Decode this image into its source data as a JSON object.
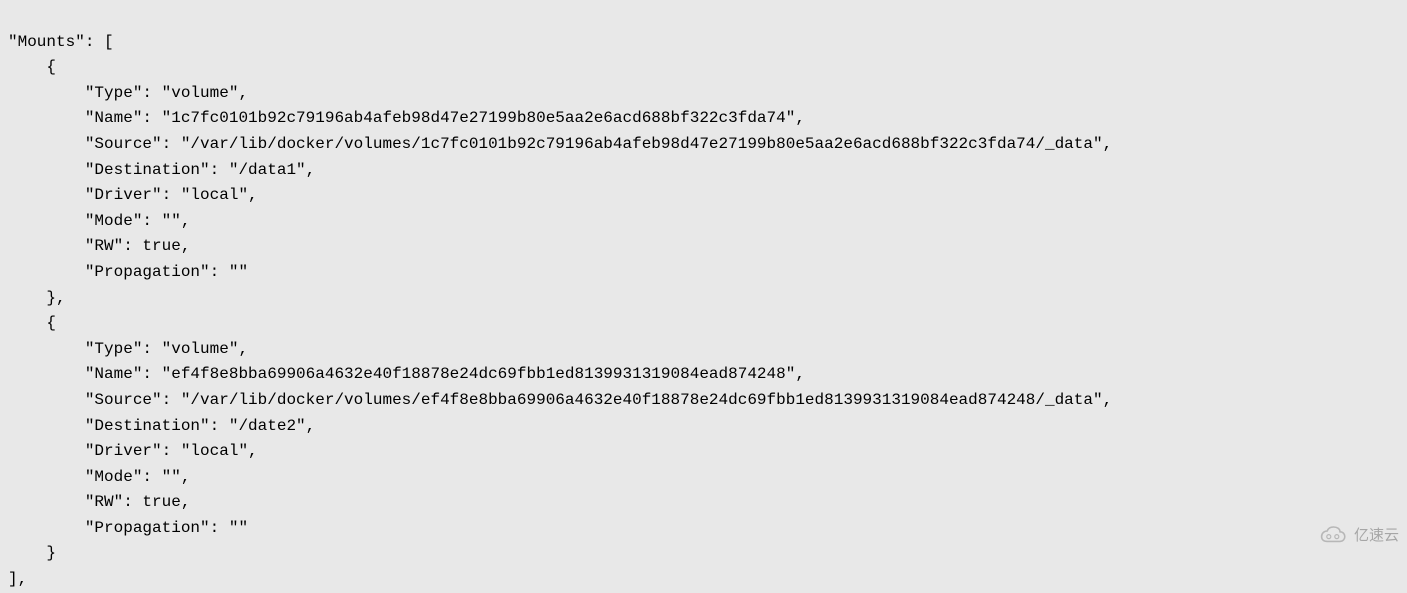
{
  "code": {
    "key_mounts": "\"Mounts\": [",
    "open_brace1": "    {",
    "mount1": {
      "type": "        \"Type\": \"volume\",",
      "name": "        \"Name\": \"1c7fc0101b92c79196ab4afeb98d47e27199b80e5aa2e6acd688bf322c3fda74\",",
      "source": "        \"Source\": \"/var/lib/docker/volumes/1c7fc0101b92c79196ab4afeb98d47e27199b80e5aa2e6acd688bf322c3fda74/_data\",",
      "destination": "        \"Destination\": \"/data1\",",
      "driver": "        \"Driver\": \"local\",",
      "mode": "        \"Mode\": \"\",",
      "rw": "        \"RW\": true,",
      "propagation": "        \"Propagation\": \"\""
    },
    "close_brace1": "    },",
    "open_brace2": "    {",
    "mount2": {
      "type": "        \"Type\": \"volume\",",
      "name": "        \"Name\": \"ef4f8e8bba69906a4632e40f18878e24dc69fbb1ed8139931319084ead874248\",",
      "source": "        \"Source\": \"/var/lib/docker/volumes/ef4f8e8bba69906a4632e40f18878e24dc69fbb1ed8139931319084ead874248/_data\",",
      "destination": "        \"Destination\": \"/date2\",",
      "driver": "        \"Driver\": \"local\",",
      "mode": "        \"Mode\": \"\",",
      "rw": "        \"RW\": true,",
      "propagation": "        \"Propagation\": \"\""
    },
    "close_brace2": "    }",
    "close_array": "],"
  },
  "watermark": {
    "text": "亿速云"
  }
}
